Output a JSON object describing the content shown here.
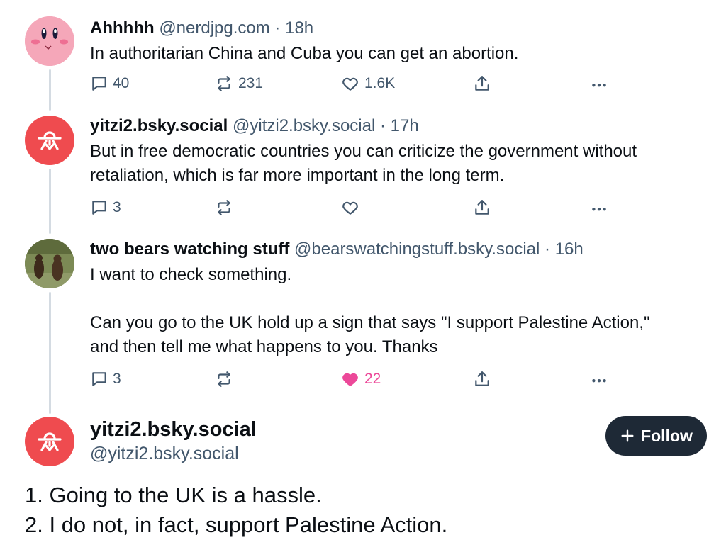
{
  "posts": [
    {
      "name": "Ahhhhh",
      "handle": "@nerdjpg.com",
      "dot": "·",
      "time": "18h",
      "text": "In authoritarian China and Cuba you can get an abortion.",
      "replies": "40",
      "reposts": "231",
      "likes": "1.6K",
      "liked": false
    },
    {
      "name": "yitzi2.bsky.social",
      "handle": "@yitzi2.bsky.social",
      "dot": "·",
      "time": "17h",
      "text": "But in free democratic countries you can criticize the government without retaliation, which is far more important in the long term.",
      "replies": "3",
      "reposts": "",
      "likes": "",
      "liked": false
    },
    {
      "name": "two bears watching stuff",
      "handle": "@bearswatchingstuff.bsky.social",
      "dot": "·",
      "time": "16h",
      "text": "I want to check something.\n\nCan you go to the UK hold up a sign that says \"I support Palestine Action,\" and then tell me what happens to you. Thanks",
      "replies": "3",
      "reposts": "",
      "likes": "22",
      "liked": true
    }
  ],
  "main_post": {
    "name": "yitzi2.bsky.social",
    "handle": "@yitzi2.bsky.social",
    "follow_label": "Follow",
    "follow_icon": "plus-icon",
    "text_line1": "1. Going to the UK is a hassle.",
    "text_line2": "2. I do not, in fact, support Palestine Action."
  },
  "colors": {
    "muted": "#42576c",
    "like": "#ec4899",
    "avatar_red": "#ef4b4f",
    "follow_bg": "#1e2936"
  },
  "icons": [
    "reply-icon",
    "repost-icon",
    "like-icon",
    "share-icon",
    "more-icon"
  ]
}
